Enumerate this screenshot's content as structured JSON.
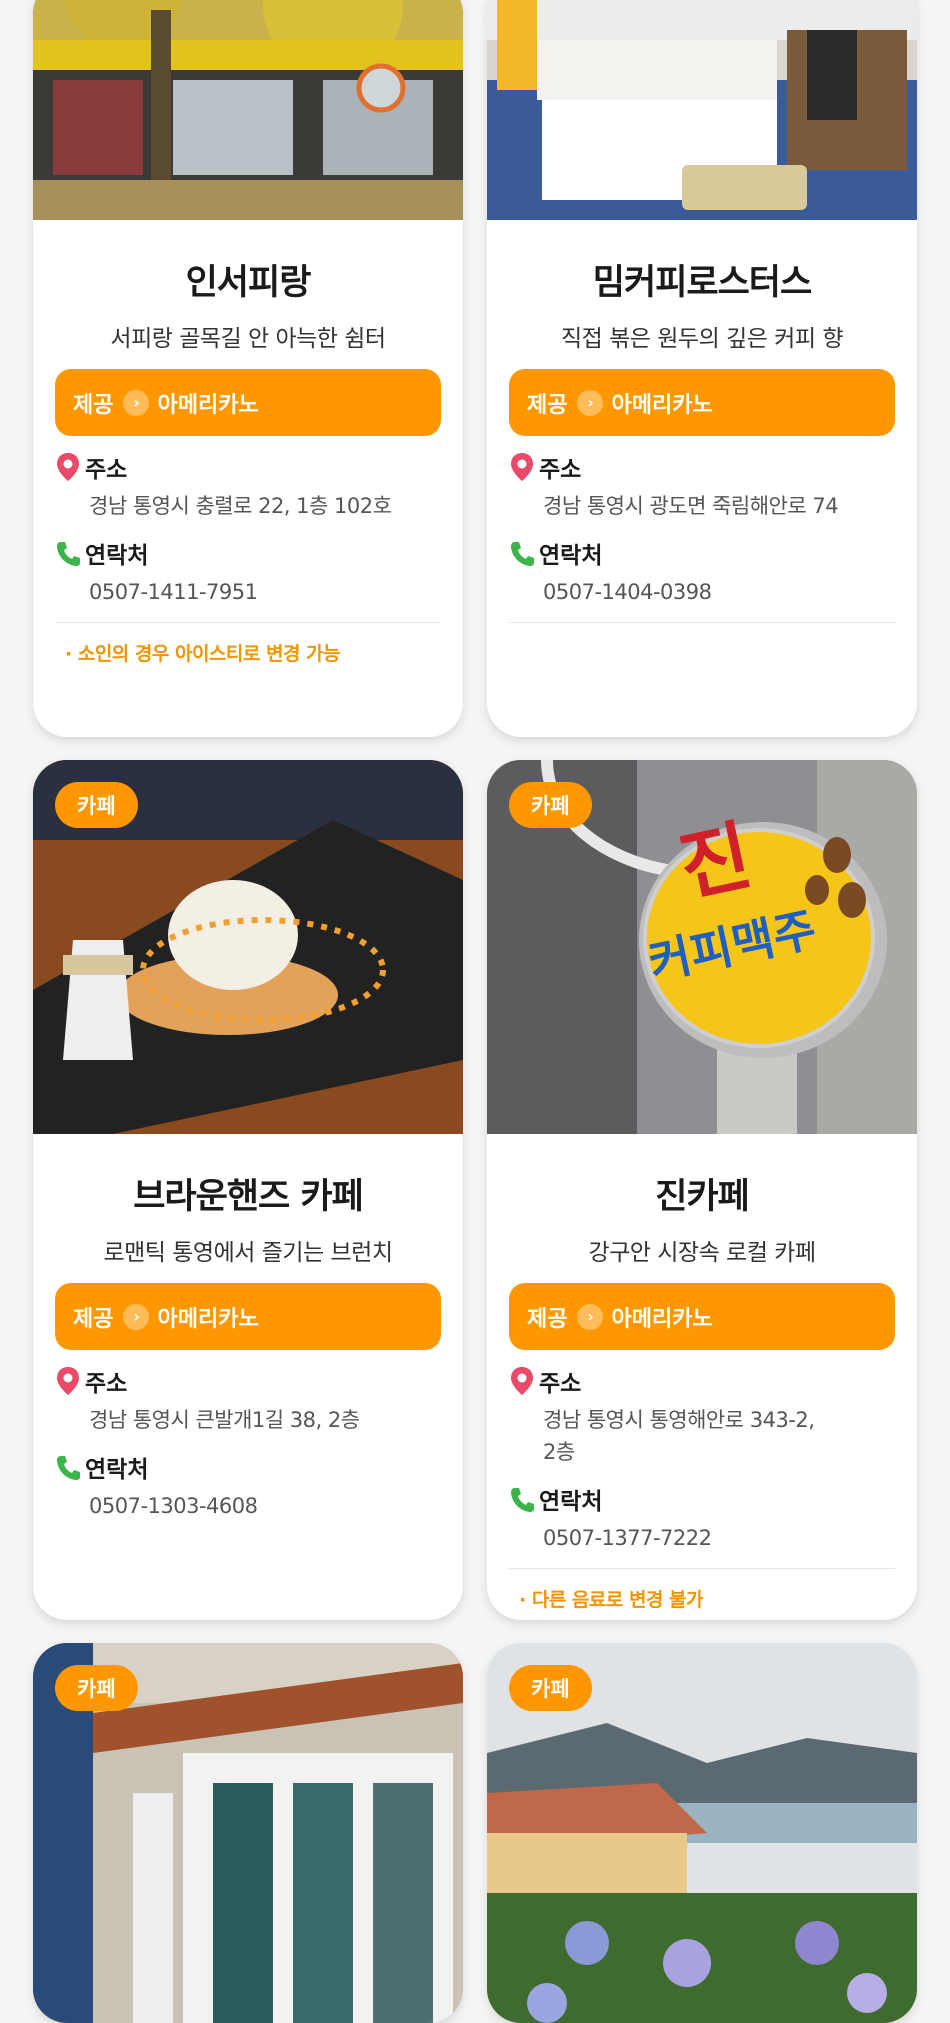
{
  "cards": [
    {
      "title": "인서피랑",
      "desc": "서피랑 골목길 안 아늑한 쉼터",
      "provide_label": "제공",
      "provide_item": "아메리카노",
      "address_label": "주소",
      "address": "경남 통영시 충렬로 22, 1층 102호",
      "contact_label": "연락처",
      "phone": "0507-1411-7951",
      "note": "· 소인의 경우 아이스티로 변경 가능"
    },
    {
      "title": "밈커피로스터스",
      "desc": "직접 볶은 원두의 깊은 커피 향",
      "provide_label": "제공",
      "provide_item": "아메리카노",
      "address_label": "주소",
      "address": "경남 통영시 광도면 죽림해안로 74",
      "contact_label": "연락처",
      "phone": "0507-1404-0398"
    },
    {
      "category": "카페",
      "title": "브라운핸즈 카페",
      "desc": "로맨틱 통영에서 즐기는 브런치",
      "provide_label": "제공",
      "provide_item": "아메리카노",
      "address_label": "주소",
      "address": "경남 통영시 큰발개1길 38, 2층",
      "contact_label": "연락처",
      "phone": "0507-1303-4608"
    },
    {
      "category": "카페",
      "title": "진카페",
      "desc": "강구안 시장속 로컬 카페",
      "provide_label": "제공",
      "provide_item": "아메리카노",
      "address_label": "주소",
      "address": "경남 통영시 통영해안로 343-2, 2층",
      "contact_label": "연락처",
      "phone": "0507-1377-7222",
      "note": "· 다른 음료로 변경 불가",
      "sign_big": "진",
      "sign_small": "커피맥주"
    },
    {
      "category": "카페"
    },
    {
      "category": "카페"
    }
  ],
  "colors": {
    "accent": "#ff9800",
    "pin": "#e94a6a",
    "phone": "#3bb54a"
  },
  "icons": [
    "location-pin-icon",
    "phone-icon",
    "chevron-right-icon"
  ]
}
